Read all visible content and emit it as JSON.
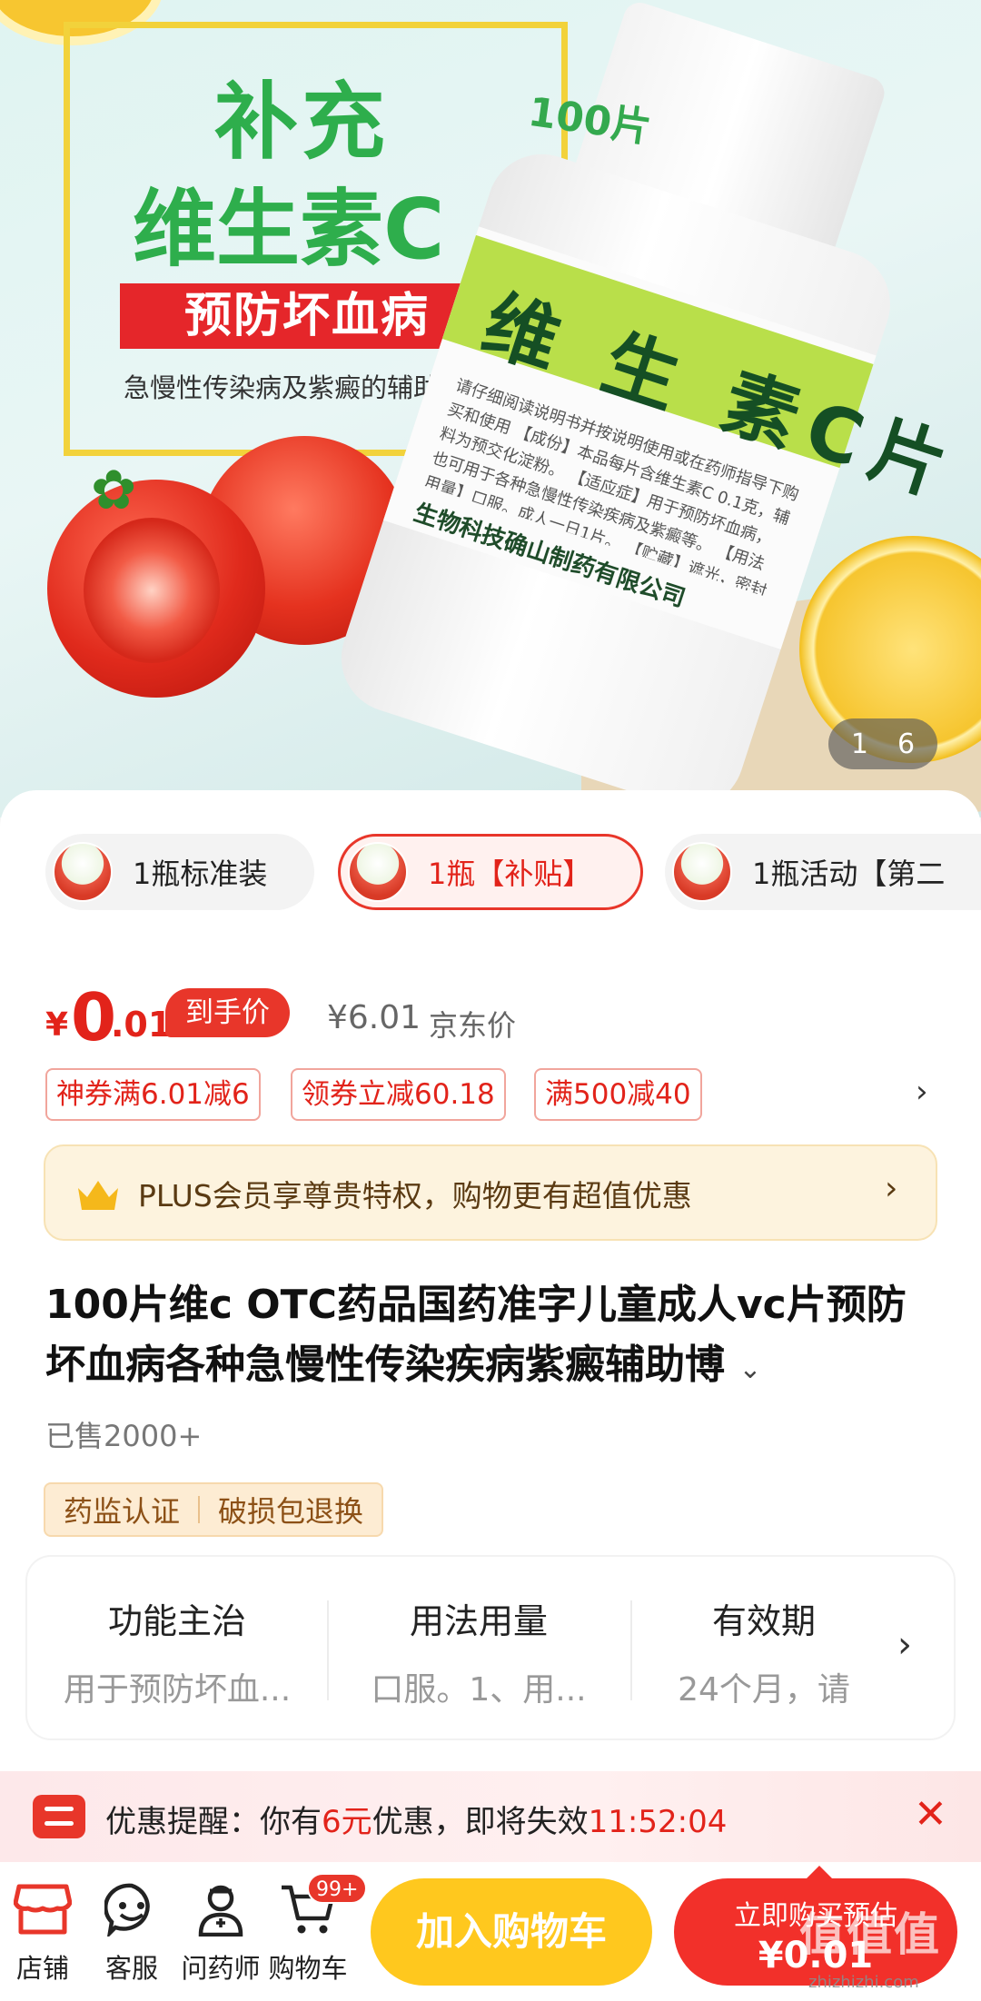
{
  "hero": {
    "line1": "补充",
    "line2": "维生素C",
    "red_band": "预防坏血病",
    "subtitle": "急慢性传染病及紫癜的辅助治疗",
    "count_badge": "100片",
    "bottle_label": "维 生 素C片",
    "bottle_small_text": "请仔细阅读说明书并按说明使用或在药师指导下购买和使用 【成份】本品每片含维生素C 0.1克，辅料为预交化淀粉。 【适应症】用于预防坏血病，也可用于各种急慢性传染疾病及紫癜等。 【用法用量】口服。成人一日1片。 【贮藏】遮光，密封保存。 【产品批号】 【生产日期】 【有效期至】",
    "bottle_maker": "生物科技确山制药有限公司",
    "pager_current": "1",
    "pager_total": "6"
  },
  "variants": [
    {
      "label": "1瓶标准装",
      "selected": false
    },
    {
      "label": "1瓶【补贴】",
      "selected": true
    },
    {
      "label": "1瓶活动【第二",
      "selected": false
    }
  ],
  "price": {
    "currency": "¥",
    "integer": "0",
    "decimal": ".01",
    "tag": "到手价",
    "jd_price": "¥6.01",
    "jd_label": "京东价"
  },
  "coupons": [
    "神券满6.01减6",
    "领券立减60.18",
    "满500减40"
  ],
  "plus": {
    "text": "PLUS会员享尊贵特权，购物更有超值优惠"
  },
  "product": {
    "title": "100片维c OTC药品国药准字儿童成人vc片预防坏血病各种急慢性传染疾病紫癜辅助博",
    "sold": "已售2000+"
  },
  "badges": [
    "药监认证",
    "破损包退换"
  ],
  "info": [
    {
      "heading": "功能主治",
      "value": "用于预防坏血..."
    },
    {
      "heading": "用法用量",
      "value": "口服。1、用..."
    },
    {
      "heading": "有效期",
      "value": "24个月，请"
    }
  ],
  "reminder": {
    "prefix": "优惠提醒：你有",
    "amount": "6元",
    "middle": "优惠，即将失效",
    "countdown": "11:52:04"
  },
  "bottom": {
    "shop": "店铺",
    "service": "客服",
    "pharmacist": "问药师",
    "cart": "购物车",
    "cart_badge": "99+",
    "add_to_cart": "加入购物车",
    "buy_now": "立即购买预估",
    "buy_price": "¥0.01"
  },
  "watermark": {
    "text": "值值值",
    "domain": "zhizhizhi.com"
  },
  "colors": {
    "accent": "#e8362a",
    "yellow": "#ffc81e",
    "green": "#2eae4c"
  }
}
